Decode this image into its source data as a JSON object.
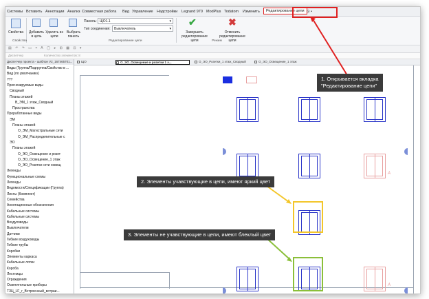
{
  "menu": {
    "items": [
      "Системы",
      "Вставить",
      "Аннотации",
      "Анализ",
      "Совместная работа",
      "Вид",
      "Управление",
      "Надстройки",
      "Legrand 970",
      "ModPlus",
      "Todatom",
      "Изменить"
    ],
    "active_tab": "Редактирование цепи",
    "extra": "⊙ •"
  },
  "ribbon": {
    "btn_properties": "Свойства",
    "btn_add": "Добавить в цепь",
    "btn_remove": "Удалить из цепи",
    "btn_select_panel": "Выбрать панель",
    "panel_label": "Панель:",
    "panel_value": "ЩО1.1",
    "conn_type_label": "Тип соединения:",
    "conn_type_value": "Выключатель",
    "btn_finish": "Завершить редактирование цепи",
    "btn_cancel": "Отменить редактирование цепи",
    "group_properties": "Свойства",
    "group_edit": "Редактирование цепи",
    "group_mode": "Режим"
  },
  "toolbar3": {
    "left": "Диспетчер",
    "mid": "Количество элементов: 8"
  },
  "sidebar": {
    "header": "Диспетчер проекта - шаблон V2_167465701...",
    "items": [
      {
        "text": "Виды (Группа/Подгруппа/Свойство в ...",
        "indent": 0
      },
      {
        "text": "Вид (по умолчанию)",
        "indent": 0
      },
      {
        "text": "???",
        "indent": 0
      },
      {
        "text": "Прогнозируемые виды",
        "indent": 0
      },
      {
        "text": "Сводный",
        "indent": 1
      },
      {
        "text": "Планы этажей",
        "indent": 1
      },
      {
        "text": "В_ЭМ_1 этаж_Сводный",
        "indent": 3
      },
      {
        "text": "Пространства",
        "indent": 2
      },
      {
        "text": "Проработанные виды",
        "indent": 0
      },
      {
        "text": "ЭМ",
        "indent": 1
      },
      {
        "text": "Планы этажей",
        "indent": 2
      },
      {
        "text": "О_ЭМ_Магистральные сети",
        "indent": 4
      },
      {
        "text": "О_ЭМ_Распределительные с",
        "indent": 4
      },
      {
        "text": "ЭО",
        "indent": 1
      },
      {
        "text": "Планы этажей",
        "indent": 2
      },
      {
        "text": "О_ЭО_Освещение и розет",
        "indent": 4
      },
      {
        "text": "О_ЭО_Освещение_1 этаж",
        "indent": 4
      },
      {
        "text": "О_ЭО_Розетки сети освещ",
        "indent": 4
      },
      {
        "text": "Легенды",
        "indent": 0
      },
      {
        "text": "Функциональные схемы",
        "indent": 0
      },
      {
        "text": "Легенды",
        "indent": 0
      },
      {
        "text": "Ведомости/Спецификации (Группа)",
        "indent": 0
      },
      {
        "text": "Листы (Комплект)",
        "indent": 0
      },
      {
        "text": "Семейства",
        "indent": 0
      },
      {
        "text": "Аннотационные обозначения",
        "indent": 0
      },
      {
        "text": "Кабельные системы",
        "indent": 0
      },
      {
        "text": "Кабельные системы",
        "indent": 0
      },
      {
        "text": "Воздуховоды",
        "indent": 0
      },
      {
        "text": "Выключатели",
        "indent": 0
      },
      {
        "text": "Датчики",
        "indent": 0
      },
      {
        "text": "Гибкие воздуховоды",
        "indent": 0
      },
      {
        "text": "Гибкие трубы",
        "indent": 0
      },
      {
        "text": "Коробки",
        "indent": 0
      },
      {
        "text": "Элементы каркаса",
        "indent": 0
      },
      {
        "text": "Кабельные лотки",
        "indent": 0
      },
      {
        "text": "Короба",
        "indent": 0
      },
      {
        "text": "Лестницы",
        "indent": 0
      },
      {
        "text": "Ограждения",
        "indent": 0
      },
      {
        "text": "Осветительные приборы",
        "indent": 0
      },
      {
        "text": "ТЗЦ_LF_r_Встроенный_встраи...",
        "indent": 0
      }
    ]
  },
  "view_tabs": [
    {
      "label": "ЩО",
      "active": false
    },
    {
      "label": "О_ЭО_Освещение и розетки 1 э...",
      "active": true
    },
    {
      "label": "О_ЭО_Розетки_1 этаж_Сводный",
      "active": false
    },
    {
      "label": "О_ЭО_Освещение_1 этаж",
      "active": false
    }
  ],
  "callouts": {
    "c1": [
      "1. Открывается вкладка",
      "\"Редактирование цепи\""
    ],
    "c2": "2. Элементы учавствующие в цепи, имеют яркий цвет",
    "c3": "3. Элементы не учавствующие в цепи, имеют блеклый цвет"
  },
  "colors": {
    "highlight_red": "#e02020",
    "highlight_yellow": "#f3c62a",
    "highlight_green": "#8bbf3a",
    "bright_element": "#2a35c8",
    "faint_element": "#e8a0a0"
  },
  "marker": "A"
}
